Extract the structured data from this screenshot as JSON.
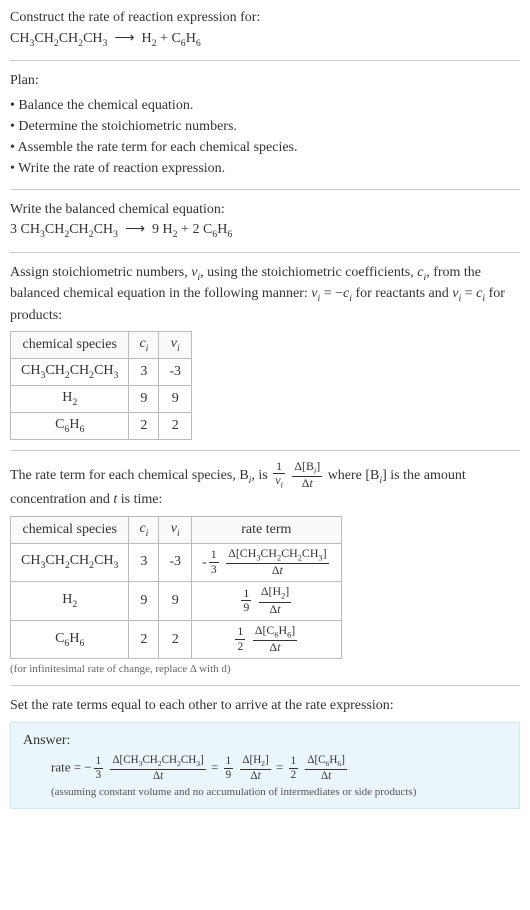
{
  "header": {
    "title": "Construct the rate of reaction expression for:"
  },
  "plan": {
    "title": "Plan:",
    "items": [
      "• Balance the chemical equation.",
      "• Determine the stoichiometric numbers.",
      "• Assemble the rate term for each chemical species.",
      "• Write the rate of reaction expression."
    ]
  },
  "balanced": {
    "title": "Write the balanced chemical equation:"
  },
  "assign": {
    "text_prefix": "Assign stoichiometric numbers, ",
    "text_mid1": ", using the stoichiometric coefficients, ",
    "text_mid2": ", from the balanced chemical equation in the following manner: ",
    "text_mid3": " for reactants and ",
    "text_end": " for products:"
  },
  "table1": {
    "headers": [
      "chemical species",
      "cᵢ",
      "νᵢ"
    ],
    "rows": [
      {
        "species": "CH3CH2CH2CH3",
        "c": "3",
        "v": "-3"
      },
      {
        "species": "H2",
        "c": "9",
        "v": "9"
      },
      {
        "species": "C6H6",
        "c": "2",
        "v": "2"
      }
    ]
  },
  "rateterm": {
    "prefix": "The rate term for each chemical species, B",
    "mid1": ", is ",
    "mid2": " where [B",
    "mid3": "] is the amount concentration and ",
    "mid4": " is time:"
  },
  "table2": {
    "headers": [
      "chemical species",
      "cᵢ",
      "νᵢ",
      "rate term"
    ],
    "rows": [
      {
        "species": "CH3CH2CH2CH3",
        "c": "3",
        "v": "-3",
        "coef_num": "1",
        "coef_den": "3",
        "neg": "-",
        "delta": "Δ[CH3CH2CH2CH3]"
      },
      {
        "species": "H2",
        "c": "9",
        "v": "9",
        "coef_num": "1",
        "coef_den": "9",
        "neg": "",
        "delta": "Δ[H2]"
      },
      {
        "species": "C6H6",
        "c": "2",
        "v": "2",
        "coef_num": "1",
        "coef_den": "2",
        "neg": "",
        "delta": "Δ[C6H6]"
      }
    ],
    "note": "(for infinitesimal rate of change, replace Δ with d)"
  },
  "final": {
    "title": "Set the rate terms equal to each other to arrive at the rate expression:"
  },
  "answer": {
    "label": "Answer:",
    "rate_prefix": "rate = ",
    "note": "(assuming constant volume and no accumulation of intermediates or side products)"
  },
  "chart_data": {
    "type": "table",
    "title": "Stoichiometric data for CH3CH2CH2CH3 → H2 + C6H6",
    "unbalanced_equation": "CH3CH2CH2CH3 → H2 + C6H6",
    "balanced_equation": "3 CH3CH2CH2CH3 → 9 H2 + 2 C6H6",
    "species": [
      {
        "name": "CH3CH2CH2CH3",
        "c_i": 3,
        "nu_i": -3,
        "rate_term": "-(1/3) Δ[CH3CH2CH2CH3]/Δt"
      },
      {
        "name": "H2",
        "c_i": 9,
        "nu_i": 9,
        "rate_term": "(1/9) Δ[H2]/Δt"
      },
      {
        "name": "C6H6",
        "c_i": 2,
        "nu_i": 2,
        "rate_term": "(1/2) Δ[C6H6]/Δt"
      }
    ],
    "rate_expression": "rate = -(1/3) Δ[CH3CH2CH2CH3]/Δt = (1/9) Δ[H2]/Δt = (1/2) Δ[C6H6]/Δt"
  }
}
